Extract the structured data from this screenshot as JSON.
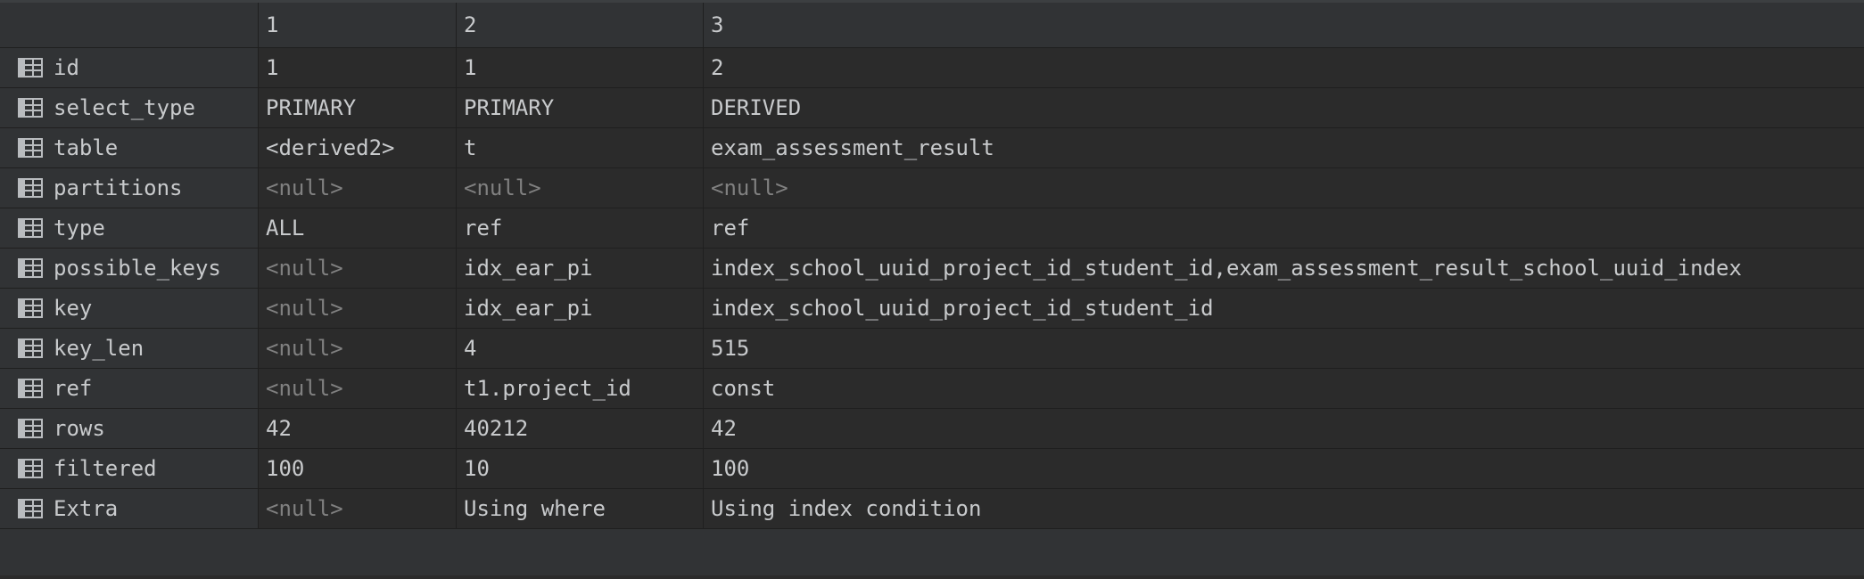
{
  "columns": [
    "",
    "1",
    "2",
    "3"
  ],
  "null_text": "<null>",
  "rows": [
    {
      "label": "id",
      "values": [
        "1",
        "1",
        "2"
      ]
    },
    {
      "label": "select_type",
      "values": [
        "PRIMARY",
        "PRIMARY",
        "DERIVED"
      ]
    },
    {
      "label": "table",
      "values": [
        "<derived2>",
        "t",
        "exam_assessment_result"
      ]
    },
    {
      "label": "partitions",
      "values": [
        null,
        null,
        null
      ]
    },
    {
      "label": "type",
      "values": [
        "ALL",
        "ref",
        "ref"
      ]
    },
    {
      "label": "possible_keys",
      "values": [
        null,
        "idx_ear_pi",
        "index_school_uuid_project_id_student_id,exam_assessment_result_school_uuid_index"
      ]
    },
    {
      "label": "key",
      "values": [
        null,
        "idx_ear_pi",
        "index_school_uuid_project_id_student_id"
      ]
    },
    {
      "label": "key_len",
      "values": [
        null,
        "4",
        "515"
      ]
    },
    {
      "label": "ref",
      "values": [
        null,
        "t1.project_id",
        "const"
      ]
    },
    {
      "label": "rows",
      "values": [
        "42",
        "40212",
        "42"
      ]
    },
    {
      "label": "filtered",
      "values": [
        "100",
        "10",
        "100"
      ]
    },
    {
      "label": "Extra",
      "values": [
        null,
        "Using where",
        "Using index condition"
      ]
    }
  ],
  "icon": "table-row-icon",
  "colors": {
    "background": "#2b2b2b",
    "header": "#313335",
    "text": "#c8cacc",
    "null_text": "#808080",
    "grid_line": "#1f1f1f"
  }
}
